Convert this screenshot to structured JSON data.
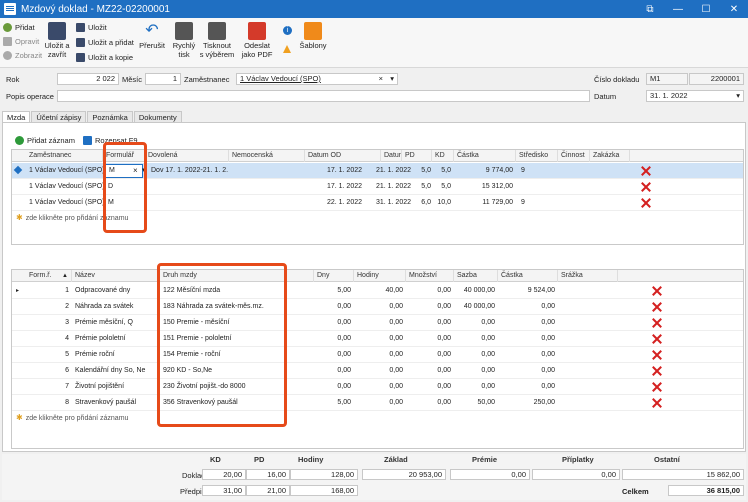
{
  "window": {
    "title": "Mzdový doklad - MZ22-02200001"
  },
  "ribbon": {
    "pridat": "Přidat",
    "opravit": "Opravit",
    "zobrazit": "Zobrazit",
    "ulozit_zavrit": [
      "Uložit a",
      "zavřít"
    ],
    "ulozit": "Uložit",
    "ulozit_pridat": "Uložit a přidat",
    "ulozit_kopie": "Uložit a kopie",
    "prerusit": "Přerušit",
    "rychly_tisk": [
      "Rychlý",
      "tisk"
    ],
    "tisknout": [
      "Tisknout",
      "s výběrem"
    ],
    "odeslat": [
      "Odeslat",
      "jako PDF"
    ],
    "sablony": "Šablony"
  },
  "header": {
    "rok_label": "Rok",
    "rok": "2 022",
    "mesic_label": "Měsíc",
    "mesic": "1",
    "zam_label": "Zaměstnanec",
    "zam": "1 Václav Vedoucí (SPO)",
    "cislo_label": "Číslo dokladu",
    "rada": "M1",
    "cislo": "2200001",
    "popis_label": "Popis operace",
    "popis": "",
    "datum_label": "Datum",
    "datum": "31. 1. 2022"
  },
  "tabs": [
    "Mzda",
    "Účetní zápisy",
    "Poznámka",
    "Dokumenty"
  ],
  "toolbar": {
    "pridat_zaznam": "Přidat záznam",
    "rozepsat": "Rozepsat F9"
  },
  "grid1": {
    "columns": [
      "Zaměstnanec",
      "Formulář",
      "Dovolená",
      "Nemocenská",
      "Datum OD",
      "Datum DO",
      "PD",
      "KD",
      "Částka",
      "Středisko",
      "Činnost",
      "Zakázka"
    ],
    "rows": [
      {
        "zam": "1 Václav Vedoucí (SPO)",
        "form": "M",
        "dov": "Dov 17. 1. 2022-21. 1. 2...",
        "nem": "",
        "od": "17. 1. 2022",
        "do": "21. 1. 2022",
        "pd": "5,0",
        "kd": "5,0",
        "castka": "9 774,00",
        "str": "9"
      },
      {
        "zam": "1 Václav Vedoucí (SPO)",
        "form": "D",
        "dov": "",
        "nem": "",
        "od": "17. 1. 2022",
        "do": "21. 1. 2022",
        "pd": "5,0",
        "kd": "5,0",
        "castka": "15 312,00",
        "str": ""
      },
      {
        "zam": "1 Václav Vedoucí (SPO)",
        "form": "M",
        "dov": "",
        "nem": "",
        "od": "22. 1. 2022",
        "do": "31. 1. 2022",
        "pd": "6,0",
        "kd": "10,0",
        "castka": "11 729,00",
        "str": "9"
      }
    ],
    "add_hint": "zde klikněte pro přidání záznamu"
  },
  "grid2": {
    "columns": [
      "Form.ř.",
      "Název",
      "Druh mzdy",
      "Dny",
      "Hodiny",
      "Množství",
      "Sazba",
      "Částka",
      "Srážka"
    ],
    "rows": [
      {
        "n": "1",
        "nazev": "Odpracované dny",
        "druh": "122 Měsíční mzda",
        "dny": "5,00",
        "hod": "40,00",
        "mn": "0,00",
        "sazba": "40 000,00",
        "castka": "9 524,00",
        "srazka": ""
      },
      {
        "n": "2",
        "nazev": "Náhrada za svátek",
        "druh": "183 Náhrada za svátek-měs.mz.",
        "dny": "0,00",
        "hod": "0,00",
        "mn": "0,00",
        "sazba": "40 000,00",
        "castka": "0,00",
        "srazka": ""
      },
      {
        "n": "3",
        "nazev": "Prémie měsíční, Q",
        "druh": "150 Premie - měsíční",
        "dny": "0,00",
        "hod": "0,00",
        "mn": "0,00",
        "sazba": "0,00",
        "castka": "0,00",
        "srazka": ""
      },
      {
        "n": "4",
        "nazev": "Prémie pololetní",
        "druh": "151 Premie - pololetní",
        "dny": "0,00",
        "hod": "0,00",
        "mn": "0,00",
        "sazba": "0,00",
        "castka": "0,00",
        "srazka": ""
      },
      {
        "n": "5",
        "nazev": "Prémie roční",
        "druh": "154 Premie - roční",
        "dny": "0,00",
        "hod": "0,00",
        "mn": "0,00",
        "sazba": "0,00",
        "castka": "0,00",
        "srazka": ""
      },
      {
        "n": "6",
        "nazev": "Kalendářní dny So, Ne",
        "druh": "920 KD - So,Ne",
        "dny": "0,00",
        "hod": "0,00",
        "mn": "0,00",
        "sazba": "0,00",
        "castka": "0,00",
        "srazka": ""
      },
      {
        "n": "7",
        "nazev": "Životní pojištění",
        "druh": "230 Životní pojišt.-do 8000",
        "dny": "0,00",
        "hod": "0,00",
        "mn": "0,00",
        "sazba": "0,00",
        "castka": "0,00",
        "srazka": ""
      },
      {
        "n": "8",
        "nazev": "Stravenkový paušál",
        "druh": "356 Stravenkový paušál",
        "dny": "5,00",
        "hod": "0,00",
        "mn": "0,00",
        "sazba": "50,00",
        "castka": "250,00",
        "srazka": ""
      }
    ],
    "add_hint": "zde klikněte pro přidání záznamu"
  },
  "footer": {
    "headers": [
      "KD",
      "PD",
      "Hodiny",
      "Základ",
      "Prémie",
      "Příplatky",
      "Ostatní"
    ],
    "doklad_label": "Doklad",
    "doklad": [
      "20,00",
      "16,00",
      "128,00",
      "20 953,00",
      "0,00",
      "0,00",
      "15 862,00"
    ],
    "predpis_label": "Předpis",
    "predpis": [
      "31,00",
      "21,00",
      "168,00"
    ],
    "celkem_label": "Celkem",
    "celkem": "36 815,00"
  },
  "colors": {
    "titlebar": "#1f6fc2",
    "selected_row": "#cfe2f6",
    "highlight_box": "#e64a19",
    "delete": "#d42020"
  }
}
